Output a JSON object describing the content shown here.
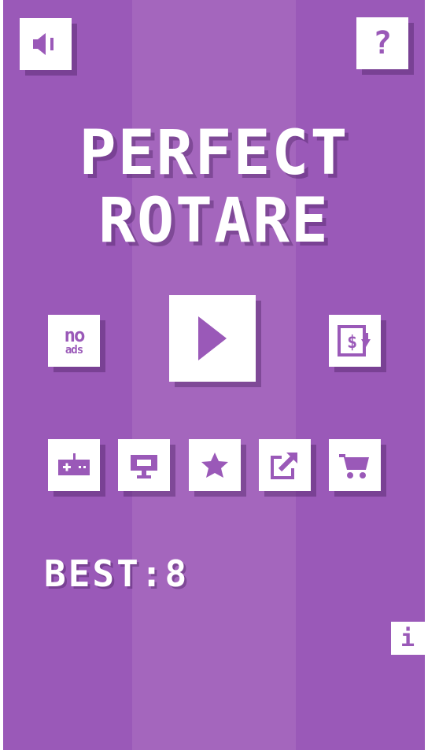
{
  "game": {
    "title_line1": "PERFECT",
    "title_line2": "ROTARE",
    "best_label": "BEST",
    "best_separator": ":",
    "best_value": "8"
  },
  "buttons": {
    "help_glyph": "?",
    "info_glyph": "i",
    "no_ads_top": "no",
    "no_ads_bottom": "ads"
  },
  "icons": {
    "sound": "speaker-icon",
    "help": "question-icon",
    "play": "play-icon",
    "no_ads": "no-ads-icon",
    "currency": "dollar-download-icon",
    "gamepad": "gamepad-icon",
    "leaderboard": "podium-icon",
    "rate": "star-icon",
    "share": "share-icon",
    "shop": "cart-icon",
    "info": "info-icon"
  },
  "colors": {
    "background": "#9a59b8",
    "center_stripe": "#a466bd",
    "button": "#ffffff",
    "icon": "#9a59b8"
  }
}
